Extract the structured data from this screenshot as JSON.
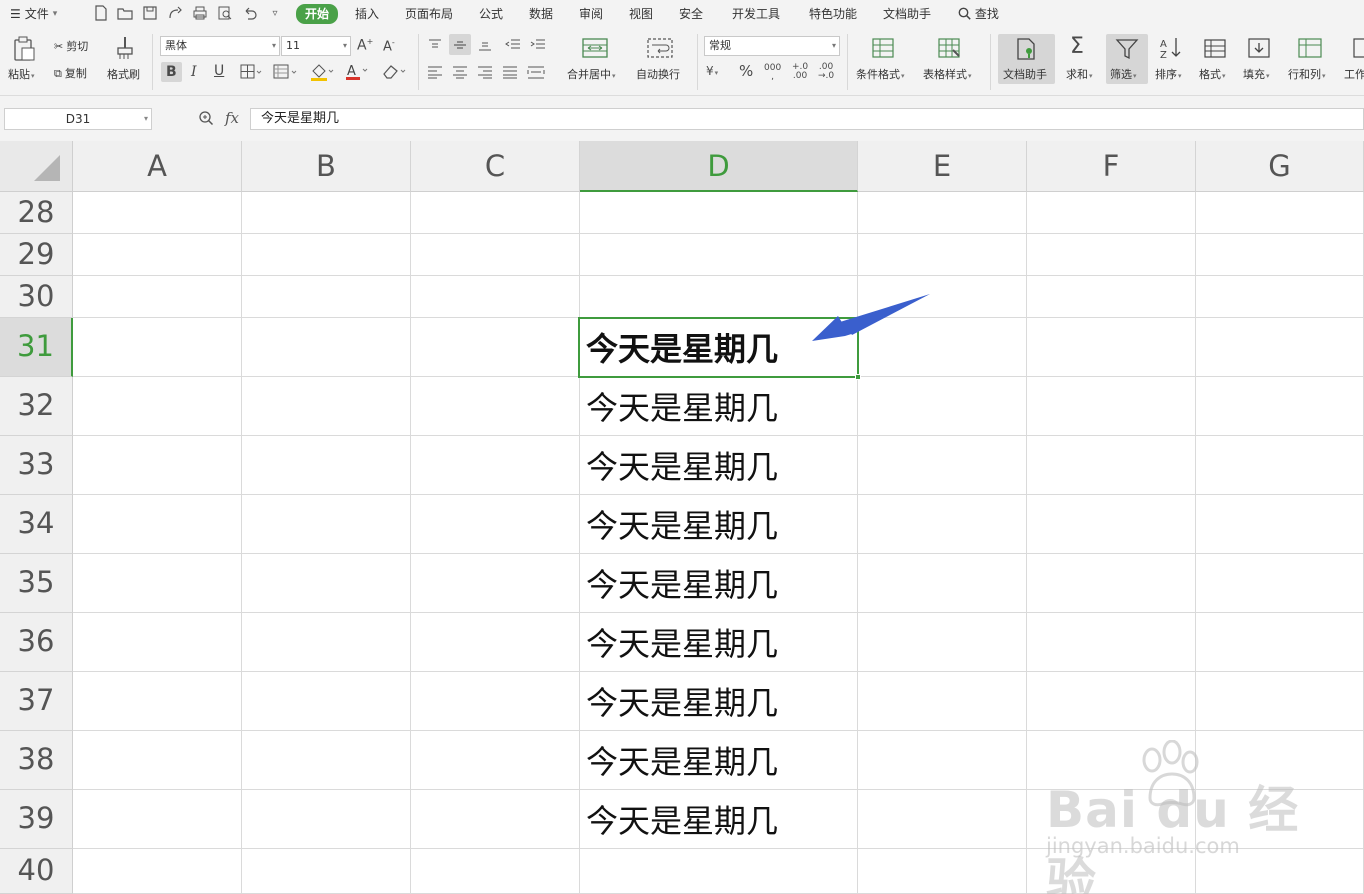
{
  "menubar": {
    "file_label": "文件",
    "tabs": [
      "开始",
      "插入",
      "页面布局",
      "公式",
      "数据",
      "审阅",
      "视图",
      "安全",
      "开发工具",
      "特色功能",
      "文档助手"
    ],
    "active_tab": "开始",
    "search_label": "查找"
  },
  "ribbon": {
    "paste_label": "粘贴",
    "cut_label": "剪切",
    "copy_label": "复制",
    "format_painter_label": "格式刷",
    "font_name": "黑体",
    "font_size": "11",
    "merge_center_label": "合并居中",
    "wrap_text_label": "自动换行",
    "number_format": "常规",
    "conditional_format_label": "条件格式",
    "table_style_label": "表格样式",
    "doc_assistant_label": "文档助手",
    "sum_label": "求和",
    "filter_label": "筛选",
    "sort_label": "排序",
    "format_label": "格式",
    "fill_label": "填充",
    "row_col_label": "行和列",
    "worksheet_label": "工作"
  },
  "formula_bar": {
    "name_box": "D31",
    "fx": "fx",
    "content": "今天是星期几"
  },
  "sheet": {
    "columns": [
      "A",
      "B",
      "C",
      "D",
      "E",
      "F",
      "G"
    ],
    "active_column": "D",
    "rows": [
      "28",
      "29",
      "30",
      "31",
      "32",
      "33",
      "34",
      "35",
      "36",
      "37",
      "38",
      "39",
      "40"
    ],
    "active_row": "31",
    "column_d_values": [
      "",
      "",
      "",
      "今天是星期几",
      "今天是星期几",
      "今天是星期几",
      "今天是星期几",
      "今天是星期几",
      "今天是星期几",
      "今天是星期几",
      "今天是星期几",
      "今天是星期几",
      ""
    ]
  },
  "colors": {
    "accent_green": "#3f9b3d",
    "arrow_blue": "#3a5fcd"
  },
  "watermark": {
    "top": "Bai du 经验",
    "bottom": "jingyan.baidu.com"
  }
}
